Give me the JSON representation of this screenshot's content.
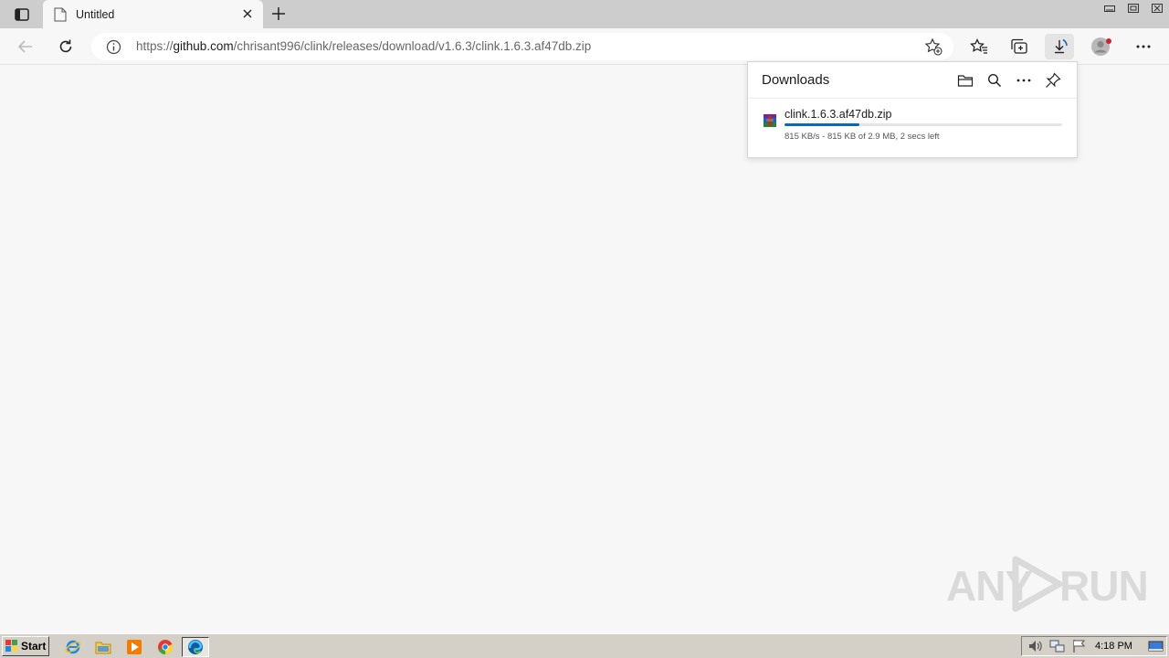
{
  "browser": {
    "tab": {
      "title": "Untitled"
    },
    "address": {
      "url_scheme": "https://",
      "url_host": "github.com",
      "url_path": "/chrisant996/clink/releases/download/v1.6.3/clink.1.6.3.af47db.zip"
    }
  },
  "downloads": {
    "title": "Downloads",
    "items": [
      {
        "filename": "clink.1.6.3.af47db.zip",
        "progress_fraction": 0.27,
        "status": "815 KB/s - 815 KB of 2.9 MB, 2 secs left",
        "file_type_icon": "winrar-archive-icon"
      }
    ]
  },
  "watermark": {
    "text_left": "ANY",
    "text_right": "RUN"
  },
  "taskbar": {
    "start_label": "Start",
    "clock": "4:18 PM",
    "apps": [
      "internet-explorer-icon",
      "folder-icon",
      "media-player-icon",
      "chrome-icon",
      "edge-icon"
    ]
  },
  "colors": {
    "accent": "#0a66c2",
    "taskbar": "#d4d0c8",
    "tabstrip": "#cdcdcd"
  }
}
